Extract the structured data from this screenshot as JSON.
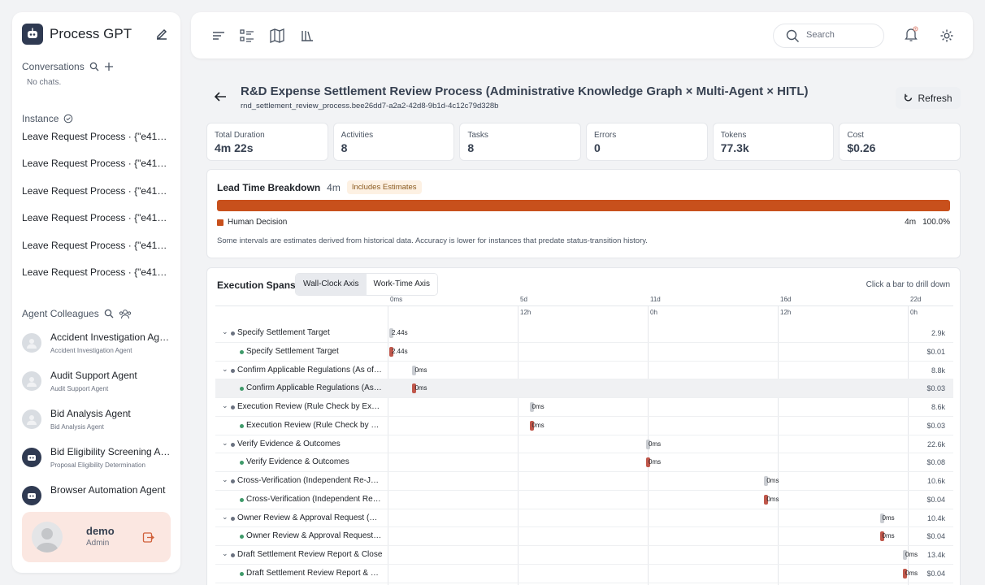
{
  "app": {
    "title": "Process GPT"
  },
  "sidebar": {
    "conversations_label": "Conversations",
    "no_chats": "No chats.",
    "instance_label": "Instance",
    "instances": [
      "Leave Request Process · {\"e41a53...",
      "Leave Request Process · {\"e41a53...",
      "Leave Request Process · {\"e41a53...",
      "Leave Request Process · {\"e41a53...",
      "Leave Request Process · {\"e41a53...",
      "Leave Request Process · {\"e41a53..."
    ],
    "agents_label": "Agent Colleagues",
    "agents": [
      {
        "name": "Accident Investigation Agent",
        "role": "Accident Investigation Agent",
        "avatar": "person-avatar"
      },
      {
        "name": "Audit Support Agent",
        "role": "Audit Support Agent",
        "avatar": "person-avatar"
      },
      {
        "name": "Bid Analysis Agent",
        "role": "Bid Analysis Agent",
        "avatar": "person-avatar"
      },
      {
        "name": "Bid Eligibility Screening Agent",
        "role": "Proposal Eligibility Determination",
        "avatar": "robot-avatar"
      },
      {
        "name": "Browser Automation Agent",
        "role": "",
        "avatar": "robot-avatar"
      }
    ],
    "user": {
      "name": "demo",
      "role": "Admin"
    }
  },
  "topbar": {
    "search_placeholder": "Search"
  },
  "process": {
    "title": "R&D Expense Settlement Review Process (Administrative Knowledge Graph × Multi-Agent × HITL)",
    "id": "rnd_settlement_review_process.bee26dd7-a2a2-42d8-9b1d-4c12c79d328b",
    "refresh_label": "Refresh"
  },
  "stats": [
    {
      "label": "Total Duration",
      "value": "4m 22s"
    },
    {
      "label": "Activities",
      "value": "8"
    },
    {
      "label": "Tasks",
      "value": "8"
    },
    {
      "label": "Errors",
      "value": "0"
    },
    {
      "label": "Tokens",
      "value": "77.3k"
    },
    {
      "label": "Cost",
      "value": "$0.26"
    }
  ],
  "lead_time": {
    "title": "Lead Time Breakdown",
    "total": "4m",
    "badge": "Includes Estimates",
    "legend_label": "Human Decision",
    "legend_value": "4m",
    "legend_percent": "100.0%",
    "fill_fraction": 1.0,
    "note": "Some intervals are estimates derived from historical data. Accuracy is lower for instances that predate status-transition history."
  },
  "spans": {
    "title": "Execution Spans",
    "mode_wall": "Wall-Clock Axis",
    "mode_work": "Work-Time Axis",
    "drill_hint": "Click a bar to drill down",
    "ticks": [
      {
        "top": "0ms",
        "bottom": ""
      },
      {
        "top": "5d",
        "bottom": "12h"
      },
      {
        "top": "11d",
        "bottom": "0h"
      },
      {
        "top": "16d",
        "bottom": "12h"
      },
      {
        "top": "22d",
        "bottom": "0h"
      }
    ],
    "rows": [
      {
        "name": "Specify Settlement Target",
        "label": "2.44s",
        "value": "2.9k",
        "child": false,
        "start_fraction": 0.0
      },
      {
        "name": "Specify Settlement Target",
        "label": "2.44s",
        "value": "$0.01",
        "child": true,
        "start_fraction": 0.0
      },
      {
        "name": "Confirm Applicable Regulations (As of Date)",
        "label": "0ms",
        "value": "8.8k",
        "child": false,
        "start_fraction": 0.045
      },
      {
        "name": "Confirm Applicable Regulations (As of Date)",
        "label": "0ms",
        "value": "$0.03",
        "child": true,
        "start_fraction": 0.045
      },
      {
        "name": "Execution Review (Rule Check by Expense Type)",
        "label": "0ms",
        "value": "8.6k",
        "child": false,
        "start_fraction": 0.273
      },
      {
        "name": "Execution Review (Rule Check by Expense Type)",
        "label": "0ms",
        "value": "$0.03",
        "child": true,
        "start_fraction": 0.273
      },
      {
        "name": "Verify Evidence & Outcomes",
        "label": "0ms",
        "value": "22.6k",
        "child": false,
        "start_fraction": 0.5
      },
      {
        "name": "Verify Evidence & Outcomes",
        "label": "0ms",
        "value": "$0.08",
        "child": true,
        "start_fraction": 0.5
      },
      {
        "name": "Cross-Verification (Independent Re-Judgment)",
        "label": "0ms",
        "value": "10.6k",
        "child": false,
        "start_fraction": 0.73
      },
      {
        "name": "Cross-Verification (Independent Re-Judgment)",
        "label": "0ms",
        "value": "$0.04",
        "child": true,
        "start_fraction": 0.73
      },
      {
        "name": "Owner Review & Approval Request (HITL)",
        "label": "0ms",
        "value": "10.4k",
        "child": false,
        "start_fraction": 0.955
      },
      {
        "name": "Owner Review & Approval Request (HITL)",
        "label": "0ms",
        "value": "$0.04",
        "child": true,
        "start_fraction": 0.955
      },
      {
        "name": "Draft Settlement Review Report & Close",
        "label": "0ms",
        "value": "13.4k",
        "child": false,
        "start_fraction": 1.0
      },
      {
        "name": "Draft Settlement Review Report & Close",
        "label": "0ms",
        "value": "$0.04",
        "child": true,
        "start_fraction": 1.0
      }
    ],
    "highlighted_row": 3
  },
  "colors": {
    "accent": "#c8501c",
    "parent_bar": "#c9ccd1",
    "child_bar": "#c0574b",
    "dot_parent": "#6b7280",
    "dot_child": "#3f9a6a"
  }
}
